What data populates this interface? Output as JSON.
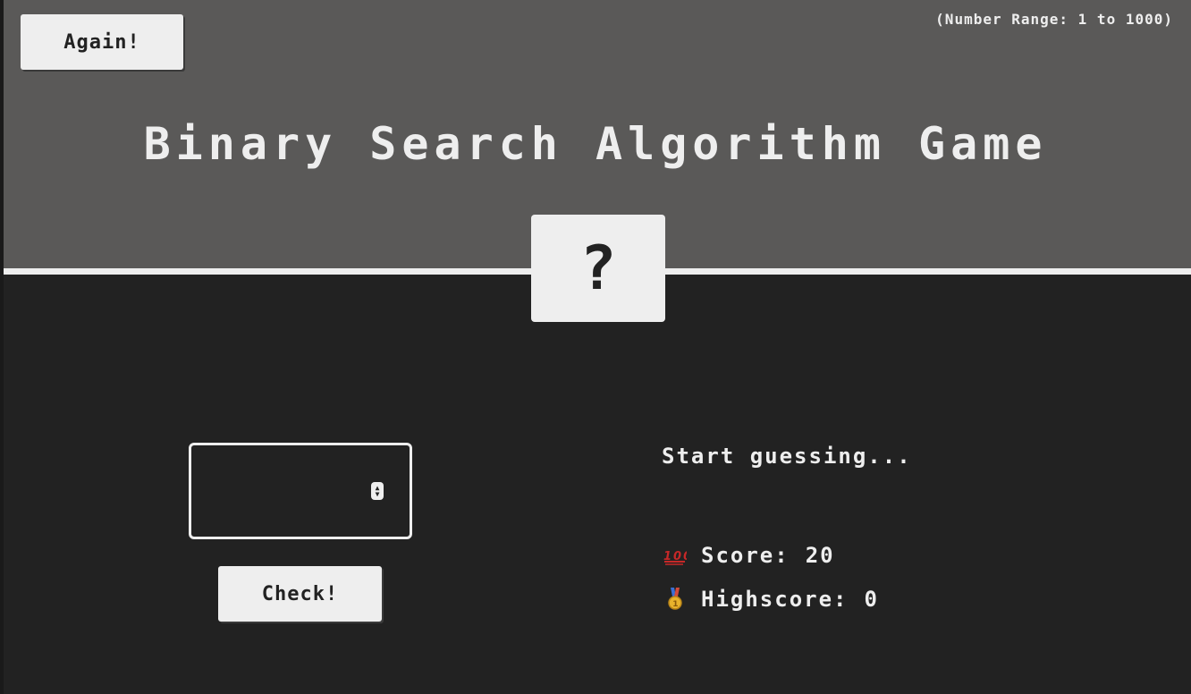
{
  "header": {
    "again_label": "Again!",
    "range_text": "(Number Range: 1 to 1000)",
    "title": "Binary Search Algorithm Game",
    "secret_number": "?"
  },
  "main": {
    "guess_value": "",
    "check_label": "Check!",
    "message": "Start guessing...",
    "score": {
      "icon": "hundred-points-icon",
      "label": "Score:",
      "value": "20"
    },
    "highscore": {
      "icon": "medal-icon",
      "label": "Highscore:",
      "value": "0"
    }
  },
  "colors": {
    "header_bg": "#5a5958",
    "body_bg": "#222222",
    "foreground": "#eeeeee",
    "score_icon": "#c62828",
    "medal_gold": "#e8b32c"
  }
}
